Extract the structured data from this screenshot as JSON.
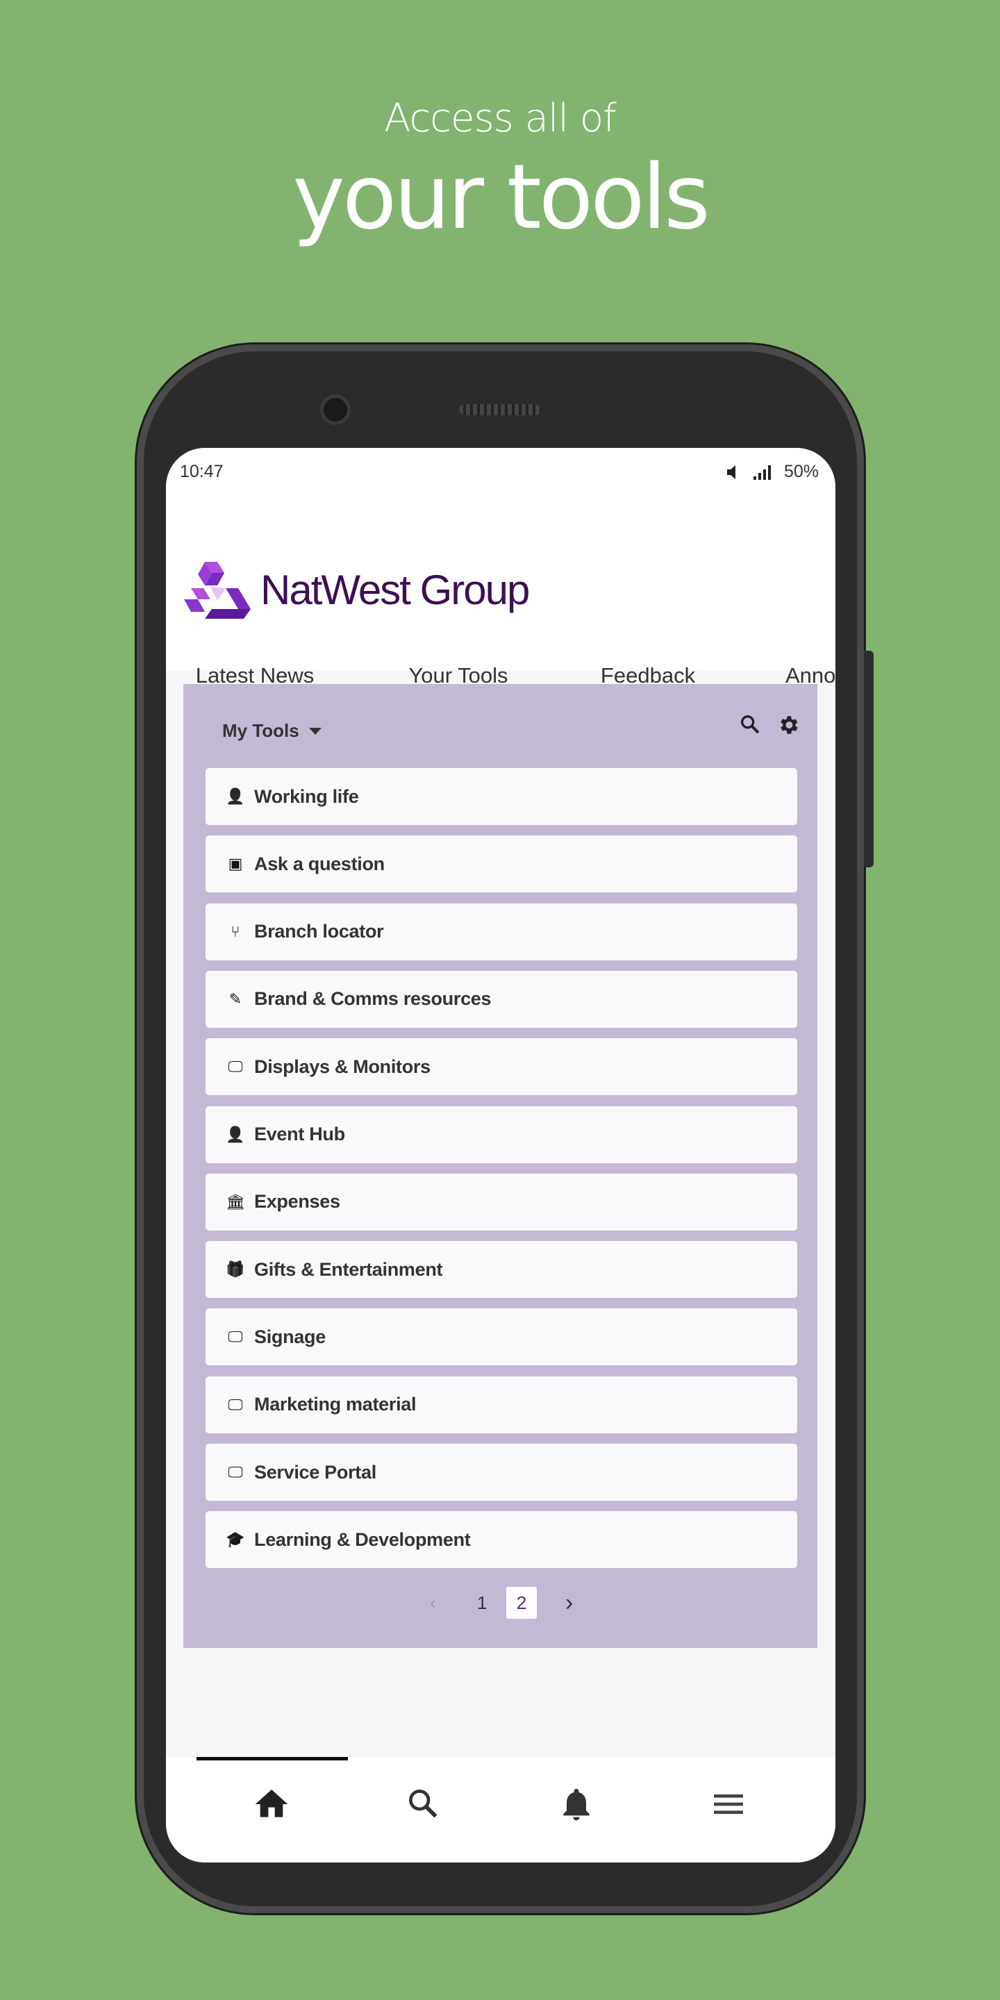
{
  "headline": {
    "line1": "Access all of",
    "line2": "your tools"
  },
  "status_bar": {
    "time": "10:47",
    "battery": "50%",
    "icons": [
      "volume-icon",
      "signal-icon"
    ]
  },
  "brand": {
    "name": "NatWest Group",
    "color": "#5a287d"
  },
  "tabs": [
    {
      "label": "Latest News"
    },
    {
      "label": "Your Tools",
      "active": true
    },
    {
      "label": "Feedback"
    },
    {
      "label": "Anno"
    }
  ],
  "panel": {
    "title": "My Tools",
    "background": "#c4b9d5",
    "items": [
      {
        "label": "Working life",
        "icon": "person-icon"
      },
      {
        "label": "Ask a question",
        "icon": "contact-card-icon"
      },
      {
        "label": "Branch locator",
        "icon": "branch-icon"
      },
      {
        "label": "Brand & Comms resources",
        "icon": "pencil-icon"
      },
      {
        "label": "Displays & Monitors",
        "icon": "monitor-icon"
      },
      {
        "label": "Event Hub",
        "icon": "speaker-person-icon"
      },
      {
        "label": "Expenses",
        "icon": "bank-icon"
      },
      {
        "label": "Gifts & Entertainment",
        "icon": "gift-icon"
      },
      {
        "label": "Signage",
        "icon": "monitor-icon"
      },
      {
        "label": "Marketing material",
        "icon": "monitor-icon"
      },
      {
        "label": "Service Portal",
        "icon": "monitor-icon"
      },
      {
        "label": "Learning & Development",
        "icon": "graduation-cap-icon"
      }
    ]
  },
  "pagination": {
    "pages": [
      "1",
      "2"
    ],
    "current": "2"
  },
  "bottom_nav": [
    {
      "icon": "home-icon",
      "active": true
    },
    {
      "icon": "search-icon"
    },
    {
      "icon": "bell-icon"
    },
    {
      "icon": "menu-icon"
    }
  ]
}
